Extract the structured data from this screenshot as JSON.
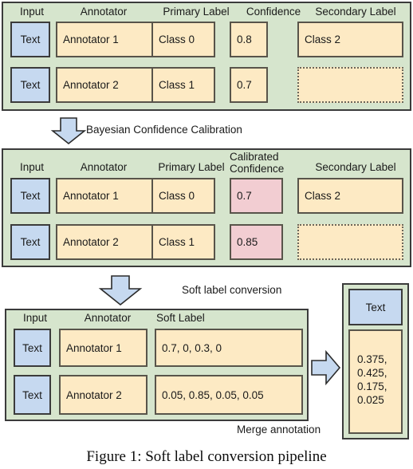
{
  "figure": {
    "caption": "Figure 1: Soft label conversion pipeline"
  },
  "colors": {
    "panel_bg": "#d6e5cd",
    "panel_border": "#3b3b3b",
    "cell_yellow": "#fdeac4",
    "cell_blue": "#c6d9f0",
    "cell_pink": "#f2cdd2",
    "cell_border": "#58544a",
    "arrow_fill": "#c6d9f0",
    "text": "#1a1a1a"
  },
  "panel1": {
    "headers": [
      "Input",
      "Annotator",
      "Primary Label",
      "Confidence",
      "Secondary Label"
    ],
    "rows": [
      {
        "input": "Text",
        "annotator": "Annotator 1",
        "primary_label": "Class 0",
        "confidence": "0.8",
        "secondary_label": "Class 2",
        "secondary_empty": false
      },
      {
        "input": "Text",
        "annotator": "Annotator 2",
        "primary_label": "Class 1",
        "confidence": "0.7",
        "secondary_label": "",
        "secondary_empty": true
      }
    ]
  },
  "step1": {
    "label": "Bayesian Confidence Calibration",
    "arrow": "down-arrow-icon"
  },
  "panel2": {
    "headers": [
      "Input",
      "Annotator",
      "Primary Label",
      "Calibrated Confidence",
      "Secondary Label"
    ],
    "calibrated_header_line1": "Calibrated",
    "calibrated_header_line2": "Confidence",
    "rows": [
      {
        "input": "Text",
        "annotator": "Annotator 1",
        "primary_label": "Class 0",
        "calibrated_confidence": "0.7",
        "secondary_label": "Class 2",
        "secondary_empty": false
      },
      {
        "input": "Text",
        "annotator": "Annotator 2",
        "primary_label": "Class 1",
        "calibrated_confidence": "0.85",
        "secondary_label": "",
        "secondary_empty": true
      }
    ]
  },
  "step2": {
    "label": "Soft label conversion",
    "arrow": "down-arrow-icon"
  },
  "panel3": {
    "headers": [
      "Input",
      "Annotator",
      "Soft Label"
    ],
    "rows": [
      {
        "input": "Text",
        "annotator": "Annotator 1",
        "soft_label": "0.7, 0, 0.3, 0"
      },
      {
        "input": "Text",
        "annotator": "Annotator 2",
        "soft_label": "0.05, 0.85, 0.05, 0.05"
      }
    ]
  },
  "step3": {
    "label": "Merge annotation",
    "arrow": "right-arrow-icon"
  },
  "merged": {
    "input": "Text",
    "values": "0.375,\n0.425,\n0.175,\n0.025"
  }
}
